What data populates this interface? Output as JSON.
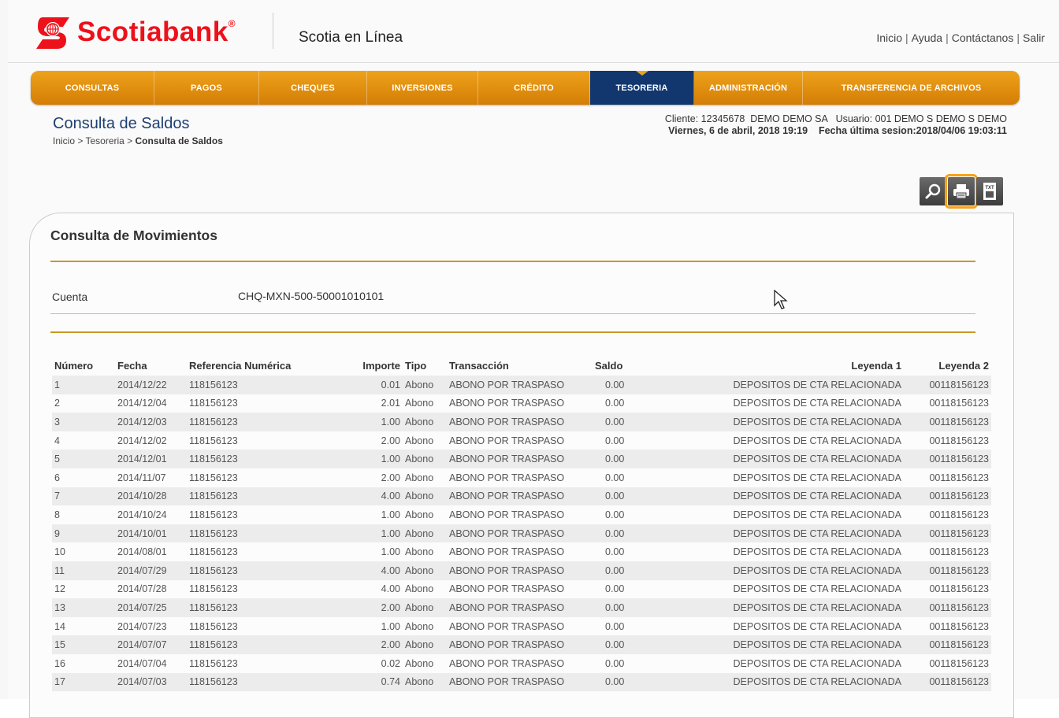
{
  "header": {
    "brand": "Scotiabank",
    "brand_mark": "®",
    "subbrand": "Scotia en Línea",
    "links": [
      "Inicio",
      "Ayuda",
      "Contáctanos",
      "Salir"
    ],
    "brand_color": "#ec111a"
  },
  "nav": {
    "tabs": [
      {
        "label": "CONSULTAS"
      },
      {
        "label": "PAGOS"
      },
      {
        "label": "CHEQUES"
      },
      {
        "label": "INVERSIONES"
      },
      {
        "label": "CRÉDITO"
      },
      {
        "label": "TESORERIA"
      },
      {
        "label": "ADMINISTRACIÓN"
      },
      {
        "label": "TRANSFERENCIA DE ARCHIVOS"
      }
    ],
    "active": "TESORERIA",
    "accent_color": "#e69213",
    "active_color": "#12376e"
  },
  "page": {
    "title": "Consulta de Saldos",
    "breadcrumb_prefix": "Inicio > Tesoreria > ",
    "breadcrumb_current": "Consulta de Saldos",
    "client_line": "Cliente: 12345678  DEMO DEMO SA   Usuario: 001 DEMO S DEMO S DEMO",
    "date_line": "Viernes, 6 de abril, 2018 19:19    Fecha última sesion:2018/04/06 19:03:11"
  },
  "actions": {
    "icons": [
      "search-icon",
      "print-icon",
      "txt-export-icon"
    ],
    "txt_label": "TXT",
    "highlighted": "print-icon",
    "highlight_color": "#f7a21b"
  },
  "card": {
    "title": "Consulta de Movimientos",
    "cuenta_label": "Cuenta",
    "cuenta_value": "CHQ-MXN-500-50001010101"
  },
  "table": {
    "headers": [
      "Número",
      "Fecha",
      "Referencia Numérica",
      "Importe",
      "Tipo",
      "Transacción",
      "Saldo",
      "Leyenda 1",
      "Leyenda 2"
    ],
    "rows": [
      [
        "1",
        "2014/12/22",
        "118156123",
        "0.01",
        "Abono",
        "ABONO POR TRASPASO",
        "0.00",
        "DEPOSITOS DE CTA RELACIONADA",
        "00118156123"
      ],
      [
        "2",
        "2014/12/04",
        "118156123",
        "2.01",
        "Abono",
        "ABONO POR TRASPASO",
        "0.00",
        "DEPOSITOS DE CTA RELACIONADA",
        "00118156123"
      ],
      [
        "3",
        "2014/12/03",
        "118156123",
        "1.00",
        "Abono",
        "ABONO POR TRASPASO",
        "0.00",
        "DEPOSITOS DE CTA RELACIONADA",
        "00118156123"
      ],
      [
        "4",
        "2014/12/02",
        "118156123",
        "2.00",
        "Abono",
        "ABONO POR TRASPASO",
        "0.00",
        "DEPOSITOS DE CTA RELACIONADA",
        "00118156123"
      ],
      [
        "5",
        "2014/12/01",
        "118156123",
        "1.00",
        "Abono",
        "ABONO POR TRASPASO",
        "0.00",
        "DEPOSITOS DE CTA RELACIONADA",
        "00118156123"
      ],
      [
        "6",
        "2014/11/07",
        "118156123",
        "2.00",
        "Abono",
        "ABONO POR TRASPASO",
        "0.00",
        "DEPOSITOS DE CTA RELACIONADA",
        "00118156123"
      ],
      [
        "7",
        "2014/10/28",
        "118156123",
        "4.00",
        "Abono",
        "ABONO POR TRASPASO",
        "0.00",
        "DEPOSITOS DE CTA RELACIONADA",
        "00118156123"
      ],
      [
        "8",
        "2014/10/24",
        "118156123",
        "1.00",
        "Abono",
        "ABONO POR TRASPASO",
        "0.00",
        "DEPOSITOS DE CTA RELACIONADA",
        "00118156123"
      ],
      [
        "9",
        "2014/10/01",
        "118156123",
        "1.00",
        "Abono",
        "ABONO POR TRASPASO",
        "0.00",
        "DEPOSITOS DE CTA RELACIONADA",
        "00118156123"
      ],
      [
        "10",
        "2014/08/01",
        "118156123",
        "1.00",
        "Abono",
        "ABONO POR TRASPASO",
        "0.00",
        "DEPOSITOS DE CTA RELACIONADA",
        "00118156123"
      ],
      [
        "11",
        "2014/07/29",
        "118156123",
        "4.00",
        "Abono",
        "ABONO POR TRASPASO",
        "0.00",
        "DEPOSITOS DE CTA RELACIONADA",
        "00118156123"
      ],
      [
        "12",
        "2014/07/28",
        "118156123",
        "4.00",
        "Abono",
        "ABONO POR TRASPASO",
        "0.00",
        "DEPOSITOS DE CTA RELACIONADA",
        "00118156123"
      ],
      [
        "13",
        "2014/07/25",
        "118156123",
        "2.00",
        "Abono",
        "ABONO POR TRASPASO",
        "0.00",
        "DEPOSITOS DE CTA RELACIONADA",
        "00118156123"
      ],
      [
        "14",
        "2014/07/23",
        "118156123",
        "1.00",
        "Abono",
        "ABONO POR TRASPASO",
        "0.00",
        "DEPOSITOS DE CTA RELACIONADA",
        "00118156123"
      ],
      [
        "15",
        "2014/07/07",
        "118156123",
        "2.00",
        "Abono",
        "ABONO POR TRASPASO",
        "0.00",
        "DEPOSITOS DE CTA RELACIONADA",
        "00118156123"
      ],
      [
        "16",
        "2014/07/04",
        "118156123",
        "0.02",
        "Abono",
        "ABONO POR TRASPASO",
        "0.00",
        "DEPOSITOS DE CTA RELACIONADA",
        "00118156123"
      ],
      [
        "17",
        "2014/07/03",
        "118156123",
        "0.74",
        "Abono",
        "ABONO POR TRASPASO",
        "0.00",
        "DEPOSITOS DE CTA RELACIONADA",
        "00118156123"
      ]
    ]
  }
}
